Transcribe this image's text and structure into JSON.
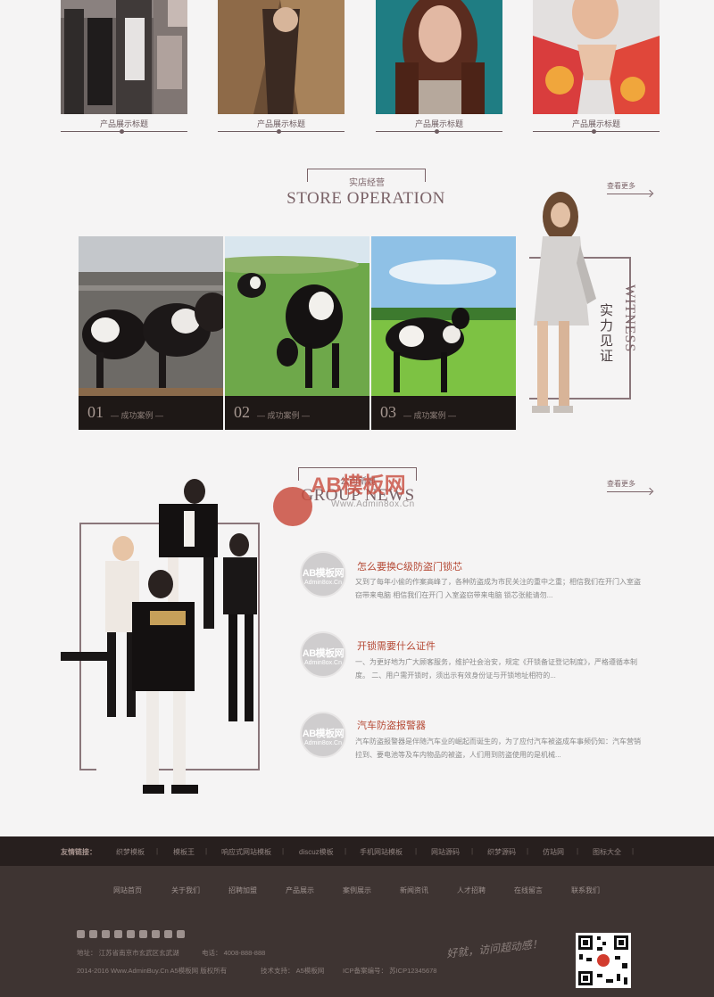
{
  "products": [
    {
      "caption": "产品展示标题"
    },
    {
      "caption": "产品展示标题"
    },
    {
      "caption": "产品展示标题"
    },
    {
      "caption": "产品展示标题"
    }
  ],
  "store": {
    "title_cn": "实店经营",
    "title_en": "STORE OPERATION",
    "more": "查看更多",
    "witness_en": "WITNESS",
    "witness_cn": "实力见证",
    "cards": [
      {
        "num": "01",
        "label": "— 成功案例 —"
      },
      {
        "num": "02",
        "label": "— 成功案例 —"
      },
      {
        "num": "03",
        "label": "— 成功案例 —"
      }
    ]
  },
  "news": {
    "title_cn": "公司新闻",
    "title_en": "GROUP NEWS",
    "more": "查看更多",
    "icon_line1": "AB模板网",
    "icon_line2": "Admin8ox.Cn",
    "items": [
      {
        "title": "怎么要换C级防盗门锁芯",
        "body": "又到了每年小偷的作案高峰了，各种防盗成为市民关注的重中之重；相信我们在开门入室盗窃带来电脑 相信我们在开门 入室盗窃带来电脑 锁芯张能请勿..."
      },
      {
        "title": "开锁需要什么证件",
        "body": "一、为更好地为广大顾客服务，维护社会治安，规定《开锁备证登记制度》，严格遵循本制度。 二、用户需开锁时，须出示有效身份证与开锁地址相符的..."
      },
      {
        "title": "汽车防盗报警器",
        "body": "汽车防盗报警器是伴随汽车业的崛起而诞生的，为了应付汽车被盗成车事频仍知：汽车营销拉到、要电池等及车内物品的被盗，人们用到防盗使用的是机械..."
      }
    ]
  },
  "watermark": {
    "logo": "AB模板网",
    "url": "Www.Admin8ox.Cn"
  },
  "friend_links": {
    "label": "友情链接：",
    "items": [
      "织梦模板",
      "模板王",
      "响应式网站模板",
      "discuz模板",
      "手机网站模板",
      "网站源码",
      "织梦源码",
      "仿站网",
      "图标大全"
    ]
  },
  "footer": {
    "nav": [
      "网站首页",
      "关于我们",
      "招聘加盟",
      "产品展示",
      "案例展示",
      "新闻资讯",
      "人才招聘",
      "在线留言",
      "联系我们"
    ],
    "address": "地址：  江苏省南京市玄武区玄武湖",
    "phone": "电话：  4008-888-888",
    "copyright": "2014-2016 Www.AdminBuy.Cn A5模板网 版权所有",
    "tech": "技术支持：  A5模板网",
    "icp": "ICP备案编号：  苏ICP12345678",
    "slogan": "好就，访问超动感！"
  }
}
